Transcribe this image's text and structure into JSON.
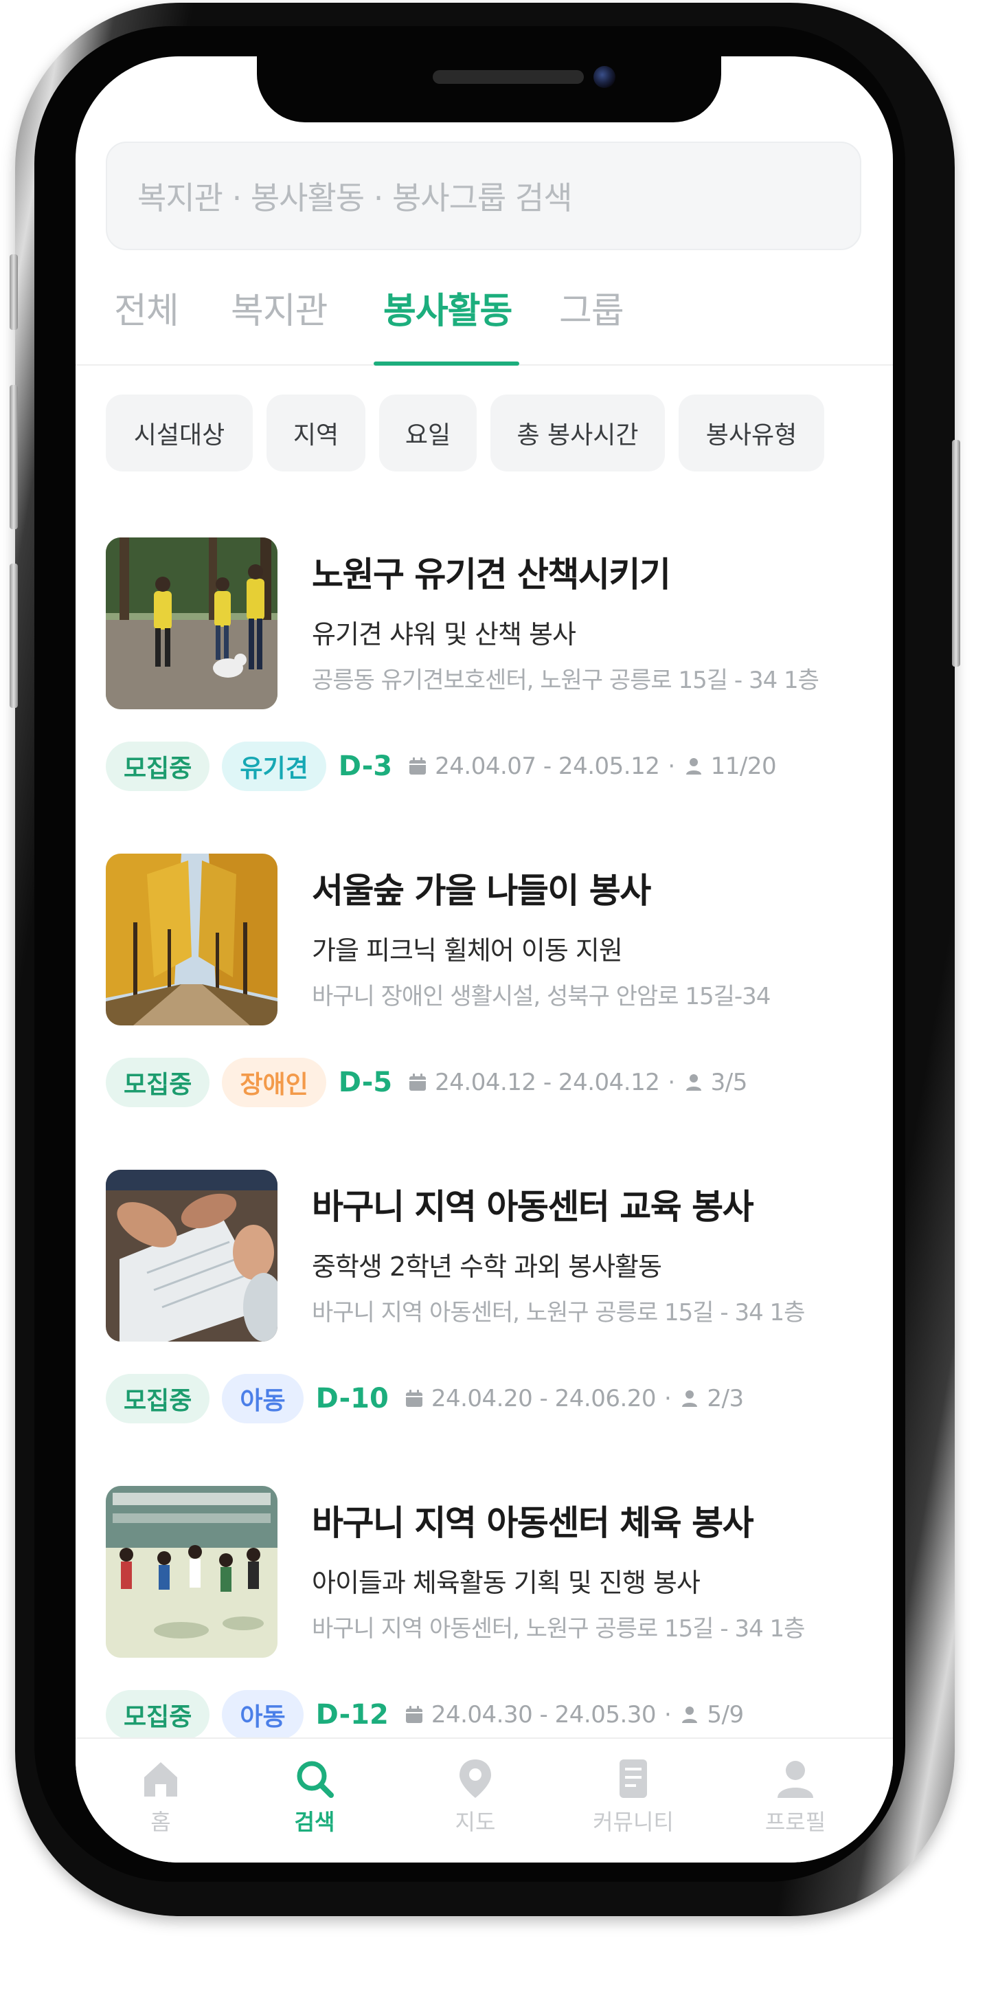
{
  "search": {
    "placeholder": "복지관 · 봉사활동 · 봉사그룹 검색"
  },
  "tabs": [
    {
      "label": "전체",
      "active": false
    },
    {
      "label": "복지관",
      "active": false
    },
    {
      "label": "봉사활동",
      "active": true
    },
    {
      "label": "그룹",
      "active": false
    }
  ],
  "filters": [
    "시설대상",
    "지역",
    "요일",
    "총 봉사시간",
    "봉사유형"
  ],
  "activities": [
    {
      "title": "노원구 유기견 산책시키기",
      "subtitle": "유기견 샤워 및 산책 봉사",
      "address": "공릉동 유기견보호센터, 노원구 공릉로 15길 - 34 1층",
      "status": "모집중",
      "category": "유기견",
      "dday": "D-3",
      "period": "24.04.07 - 24.05.12",
      "participants": "11/20",
      "thumbnail_icon": "dog-walking-photo"
    },
    {
      "title": "서울숲 가을 나들이 봉사",
      "subtitle": "가을 피크닉 휠체어 이동 지원",
      "address": "바구니 장애인 생활시설, 성북구 안암로 15길-34",
      "status": "모집중",
      "category": "장애인",
      "dday": "D-5",
      "period": "24.04.12 - 24.04.12",
      "participants": "3/5",
      "thumbnail_icon": "autumn-forest-photo"
    },
    {
      "title": "바구니 지역 아동센터 교육 봉사",
      "subtitle": "중학생 2학년 수학 과외 봉사활동",
      "address": "바구니 지역 아동센터, 노원구 공릉로 15길 - 34 1층",
      "status": "모집중",
      "category": "아동",
      "dday": "D-10",
      "period": "24.04.20 - 24.06.20",
      "participants": "2/3",
      "thumbnail_icon": "study-photo"
    },
    {
      "title": "바구니 지역 아동센터 체육 봉사",
      "subtitle": "아이들과 체육활동 기획 및 진행 봉사",
      "address": "바구니 지역 아동센터, 노원구 공릉로 15길 - 34 1층",
      "status": "모집중",
      "category": "아동",
      "dday": "D-12",
      "period": "24.04.30 - 24.05.30",
      "participants": "5/9",
      "thumbnail_icon": "sports-photo"
    }
  ],
  "bottom_nav": [
    {
      "label": "홈",
      "icon": "home-icon",
      "active": false
    },
    {
      "label": "검색",
      "icon": "search-icon",
      "active": true
    },
    {
      "label": "지도",
      "icon": "map-pin-icon",
      "active": false
    },
    {
      "label": "커뮤니티",
      "icon": "document-icon",
      "active": false
    },
    {
      "label": "프로필",
      "icon": "person-icon",
      "active": false
    }
  ],
  "colors": {
    "accent": "#1cae7d",
    "tag_dog": "#16a8b4",
    "tag_disabled": "#f39a4a",
    "tag_child": "#4b7fe8"
  }
}
